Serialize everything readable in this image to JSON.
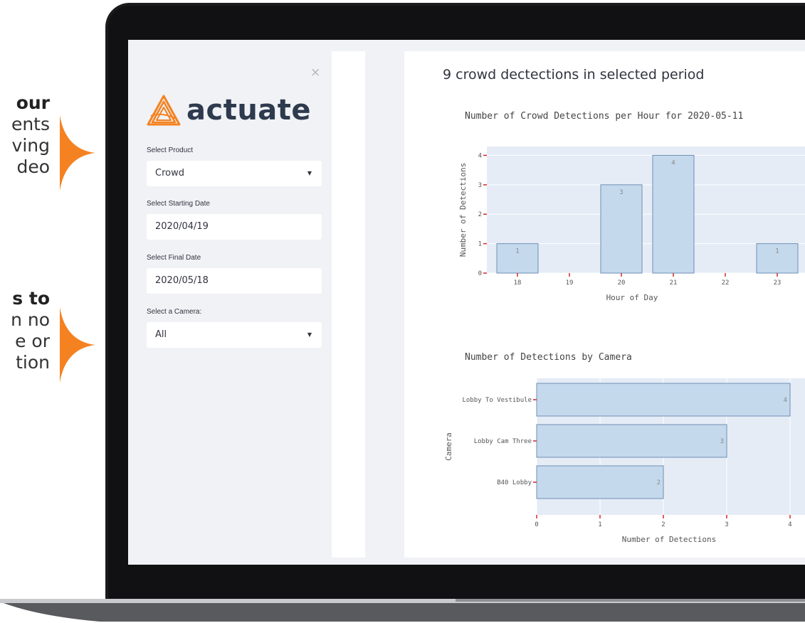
{
  "side_text": {
    "block1": [
      "our",
      "ents",
      "ving",
      "deo"
    ],
    "block2": [
      "s to",
      "n no",
      "e or",
      "tion"
    ]
  },
  "app": {
    "logo_text": "actuate",
    "close_symbol": "×",
    "product_label": "Select Product",
    "product_value": "Crowd",
    "start_label": "Select Starting Date",
    "start_value": "2020/04/19",
    "final_label": "Select Final Date",
    "final_value": "2020/05/18",
    "camera_label": "Select a Camera:",
    "camera_value": "All",
    "main_title": "9 crowd dectections in selected period"
  },
  "colors": {
    "accent_orange": "#f58220",
    "bar_fill": "#c5d9ec",
    "bar_stroke": "#6e8fb5",
    "plot_bg": "#e5ecf6",
    "tick_red": "#d62728"
  },
  "chart_data": [
    {
      "type": "bar",
      "title": "Number of Crowd Detections per Hour for 2020-05-11",
      "xlabel": "Hour of Day",
      "ylabel": "Number of Detections",
      "categories": [
        "18",
        "19",
        "20",
        "21",
        "22",
        "23"
      ],
      "values": [
        1,
        0,
        3,
        4,
        0,
        1
      ],
      "data_labels": [
        "1",
        "",
        "3",
        "4",
        "",
        "1"
      ],
      "ylim": [
        0,
        4.3
      ],
      "yticks": [
        "0",
        "1",
        "2",
        "3",
        "4"
      ],
      "grid": true
    },
    {
      "type": "bar",
      "orientation": "horizontal",
      "title": "Number of Detections by Camera",
      "xlabel": "Number of Detections",
      "ylabel": "Camera",
      "categories": [
        "Lobby To Vestibule",
        "Lobby Cam Three",
        "B40 Lobby"
      ],
      "values": [
        4,
        3,
        2
      ],
      "data_labels": [
        "4",
        "3",
        "2"
      ],
      "xlim": [
        0,
        4.2
      ],
      "xticks": [
        "0",
        "1",
        "2",
        "3",
        "4"
      ],
      "grid": true
    }
  ]
}
